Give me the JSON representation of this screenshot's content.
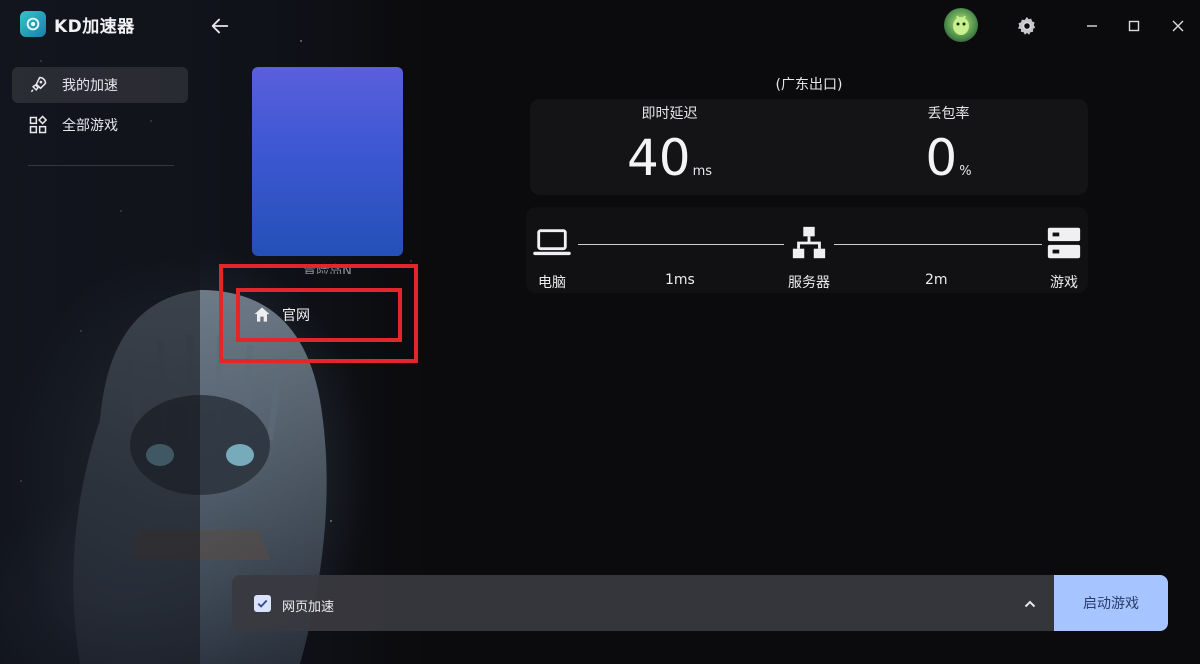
{
  "app": {
    "title": "KD加速器"
  },
  "sidebar": {
    "items": [
      {
        "label": "我的加速",
        "icon": "rocket-icon",
        "active": true
      },
      {
        "label": "全部游戏",
        "icon": "apps-grid-icon",
        "active": false
      }
    ]
  },
  "game": {
    "title": "冒险岛N",
    "official_label": "官网"
  },
  "stats": {
    "region": "(广东出口)",
    "latency_label": "即时延迟",
    "latency_value": "40",
    "latency_unit": "ms",
    "loss_label": "丢包率",
    "loss_value": "0",
    "loss_unit": "%"
  },
  "route": {
    "pc_label": "电脑",
    "pc_to_server": "1ms",
    "server_label": "服务器",
    "server_to_game": "2m",
    "game_label": "游戏"
  },
  "bottom": {
    "web_accel_label": "网页加速",
    "web_accel_checked": true,
    "launch_label": "启动游戏"
  },
  "colors": {
    "accent_button": "#a6c4ff",
    "highlight": "#e3262b",
    "cover_top": "#5b5fdc",
    "cover_bottom": "#2450b8"
  }
}
